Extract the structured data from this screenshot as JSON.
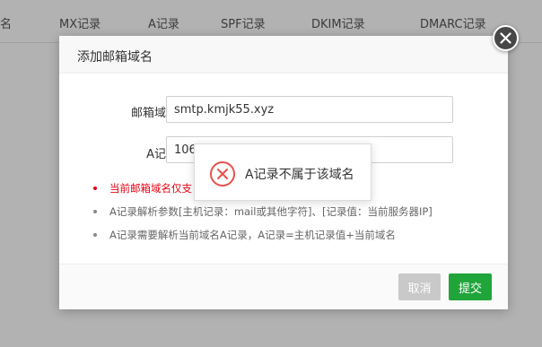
{
  "background": {
    "columns": [
      "名",
      "MX记录",
      "A记录",
      "SPF记录",
      "DKIM记录",
      "DMARC记录"
    ]
  },
  "modal": {
    "title": "添加邮箱域名",
    "domain_label": "邮箱域名",
    "domain_value": "smtp.kmjk55.xyz",
    "a_record_label": "A记录",
    "a_record_value": "106.",
    "tips": [
      "当前邮箱域名仅支",
      "A记录解析参数[主机记录：mail或其他字符]、[记录值：当前服务器IP]",
      "A记录需要解析当前域名A记录，A记录=主机记录值+当前域名"
    ],
    "cancel_label": "取消",
    "submit_label": "提交"
  },
  "toast": {
    "message": "A记录不属于该域名"
  },
  "colors": {
    "primary": "#20a53a",
    "cancel": "#c9c9c9",
    "error": "#e60012"
  },
  "icons": {
    "close": "close-icon",
    "error": "error-circle-icon"
  }
}
